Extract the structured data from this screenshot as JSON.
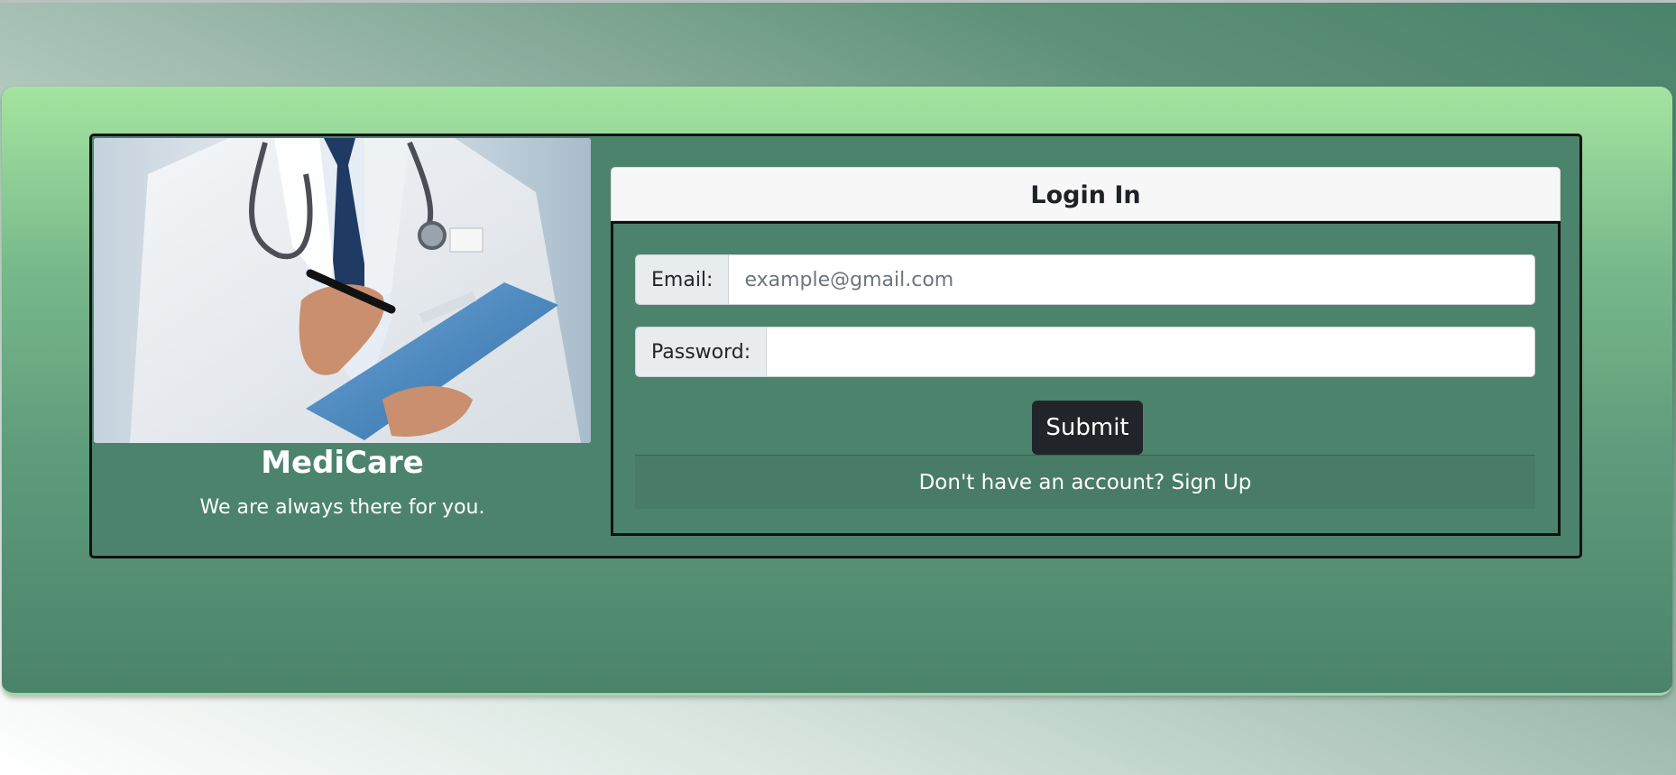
{
  "brand": {
    "name": "MediCare",
    "tagline": "We are always there for you."
  },
  "login": {
    "title": "Login In",
    "email_label": "Email:",
    "email_placeholder": "example@gmail.com",
    "email_value": "",
    "password_label": "Password:",
    "password_value": "",
    "submit_label": "Submit",
    "footer_text": "Don't have an account?",
    "signup_link": "Sign Up"
  },
  "colors": {
    "card_bg": "#4c836d",
    "button_bg": "#212529",
    "panel_top": "#a4e4a0"
  },
  "image": {
    "subject": "doctor-with-clipboard-photo"
  }
}
